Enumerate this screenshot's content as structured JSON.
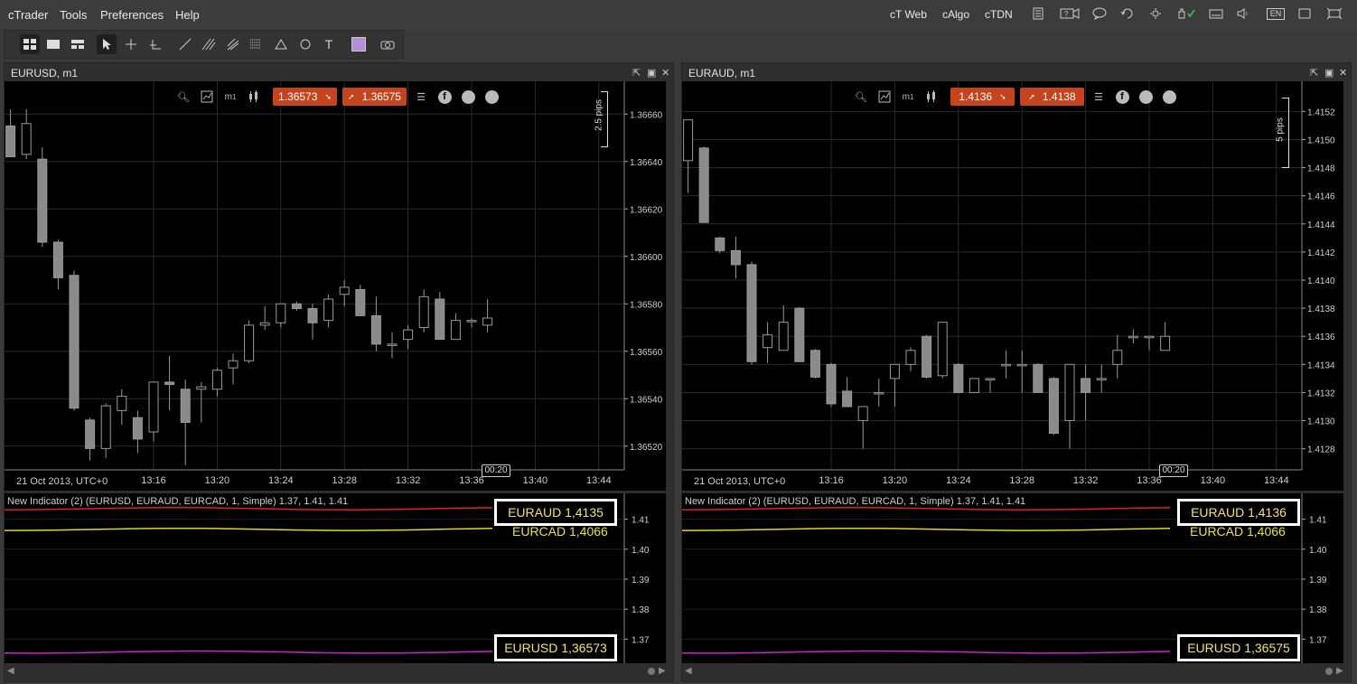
{
  "menu": {
    "items": [
      "cTrader",
      "Tools",
      "Preferences",
      "Help"
    ]
  },
  "top_links": [
    "cT Web",
    "cAlgo",
    "cTDN"
  ],
  "top_icons": [
    "notes-icon",
    "video-icon",
    "chat-icon",
    "refresh-icon",
    "settings-icon",
    "hand-check-icon",
    "keyboard-icon",
    "volume-icon",
    "language-icon",
    "window-icon",
    "fullscreen-icon"
  ],
  "language": "EN",
  "toolbar": {
    "tools": [
      "layout-grid-icon",
      "layout-single-icon",
      "layout-split-icon",
      "cursor-icon",
      "crosshair-icon",
      "measure-icon",
      "line-icon",
      "fib-icon",
      "pitchfork-icon",
      "fib-grid-icon",
      "triangle-icon",
      "ellipse-icon",
      "text-icon",
      "color-swatch",
      "screenshot-icon"
    ],
    "text_tool": "T",
    "swatch_color": "#b48fd6"
  },
  "panels": [
    {
      "title": "EURUSD, m1",
      "sell_price": "1.36573",
      "buy_price": "1.36575",
      "period_label": "m",
      "period_value": "1",
      "pips_label": "2.5 pips",
      "price_ticks": [
        "1.36660",
        "1.36640",
        "1.36620",
        "1.36600",
        "1.36580",
        "1.36560",
        "1.36540",
        "1.36520"
      ],
      "time_ticks": [
        "13:16",
        "13:20",
        "13:24",
        "13:28",
        "13:32",
        "13:36",
        "13:40",
        "13:44"
      ],
      "date_label": "21 Oct 2013, UTC+0",
      "countdown": "00:20",
      "indicator_label": "New Indicator (2) (EURUSD, EURAUD, EURCAD, 1, Simple) 1.37, 1.41, 1.41",
      "ind_ticks": [
        "1.41",
        "1.40",
        "1.39",
        "1.38",
        "1.37"
      ],
      "overlay_top": "EURAUD 1,4135",
      "overlay_mid": "EURCAD 1,4066",
      "overlay_bottom": "EURUSD 1,36573"
    },
    {
      "title": "EURAUD, m1",
      "sell_price": "1.4136",
      "buy_price": "1.4138",
      "period_label": "m",
      "period_value": "1",
      "pips_label": "5 pips",
      "price_ticks": [
        "1.4152",
        "1.4150",
        "1.4148",
        "1.4146",
        "1.4144",
        "1.4142",
        "1.4140",
        "1.4138",
        "1.4136",
        "1.4134",
        "1.4132",
        "1.4130",
        "1.4128"
      ],
      "time_ticks": [
        "13:16",
        "13:20",
        "13:24",
        "13:28",
        "13:32",
        "13:36",
        "13:40",
        "13:44"
      ],
      "date_label": "21 Oct 2013, UTC+0",
      "countdown": "00:20",
      "indicator_label": "New Indicator (2) (EURUSD, EURAUD, EURCAD, 1, Simple) 1.37, 1.41, 1.41",
      "ind_ticks": [
        "1.41",
        "1.40",
        "1.39",
        "1.38",
        "1.37"
      ],
      "overlay_top": "EURAUD 1,4136",
      "overlay_mid": "EURCAD 1,4066",
      "overlay_bottom": "EURUSD 1,36575"
    }
  ],
  "chart_data": [
    {
      "type": "candlestick",
      "symbol": "EURUSD",
      "timeframe": "m1",
      "ylim": [
        1.3651,
        1.3667
      ],
      "candles": [
        {
          "t": "13:07",
          "o": 1.36655,
          "h": 1.36662,
          "l": 1.36642,
          "c": 1.36642
        },
        {
          "t": "13:08",
          "o": 1.36643,
          "h": 1.36662,
          "l": 1.36641,
          "c": 1.36656
        },
        {
          "t": "13:09",
          "o": 1.36641,
          "h": 1.36646,
          "l": 1.36604,
          "c": 1.36606
        },
        {
          "t": "13:10",
          "o": 1.36606,
          "h": 1.36607,
          "l": 1.36586,
          "c": 1.36591
        },
        {
          "t": "13:11",
          "o": 1.36592,
          "h": 1.36594,
          "l": 1.36535,
          "c": 1.36536
        },
        {
          "t": "13:12",
          "o": 1.36531,
          "h": 1.36532,
          "l": 1.36514,
          "c": 1.36519
        },
        {
          "t": "13:13",
          "o": 1.36519,
          "h": 1.36538,
          "l": 1.36515,
          "c": 1.36537
        },
        {
          "t": "13:14",
          "o": 1.36535,
          "h": 1.36544,
          "l": 1.36529,
          "c": 1.36541
        },
        {
          "t": "13:15",
          "o": 1.36532,
          "h": 1.36535,
          "l": 1.36517,
          "c": 1.36523
        },
        {
          "t": "13:16",
          "o": 1.36526,
          "h": 1.36547,
          "l": 1.36522,
          "c": 1.36547
        },
        {
          "t": "13:17",
          "o": 1.36547,
          "h": 1.36558,
          "l": 1.36535,
          "c": 1.36546
        },
        {
          "t": "13:18",
          "o": 1.36544,
          "h": 1.36548,
          "l": 1.36512,
          "c": 1.3653
        },
        {
          "t": "13:19",
          "o": 1.36544,
          "h": 1.36547,
          "l": 1.3653,
          "c": 1.36545
        },
        {
          "t": "13:20",
          "o": 1.36544,
          "h": 1.36553,
          "l": 1.36541,
          "c": 1.36552
        },
        {
          "t": "13:21",
          "o": 1.36553,
          "h": 1.36559,
          "l": 1.36546,
          "c": 1.36556
        },
        {
          "t": "13:22",
          "o": 1.36556,
          "h": 1.36573,
          "l": 1.36555,
          "c": 1.36571
        },
        {
          "t": "13:23",
          "o": 1.36571,
          "h": 1.36579,
          "l": 1.36569,
          "c": 1.36572
        },
        {
          "t": "13:24",
          "o": 1.36572,
          "h": 1.3658,
          "l": 1.3657,
          "c": 1.3658
        },
        {
          "t": "13:25",
          "o": 1.3658,
          "h": 1.36581,
          "l": 1.36577,
          "c": 1.36578
        },
        {
          "t": "13:26",
          "o": 1.36578,
          "h": 1.3658,
          "l": 1.36565,
          "c": 1.36572
        },
        {
          "t": "13:27",
          "o": 1.36573,
          "h": 1.36584,
          "l": 1.3657,
          "c": 1.36582
        },
        {
          "t": "13:28",
          "o": 1.36584,
          "h": 1.3659,
          "l": 1.36579,
          "c": 1.36587
        },
        {
          "t": "13:29",
          "o": 1.36586,
          "h": 1.36588,
          "l": 1.36575,
          "c": 1.36575
        },
        {
          "t": "13:30",
          "o": 1.36575,
          "h": 1.36583,
          "l": 1.3656,
          "c": 1.36563
        },
        {
          "t": "13:31",
          "o": 1.36563,
          "h": 1.36568,
          "l": 1.36557,
          "c": 1.36563
        },
        {
          "t": "13:32",
          "o": 1.36565,
          "h": 1.36571,
          "l": 1.36561,
          "c": 1.36569
        },
        {
          "t": "13:33",
          "o": 1.3657,
          "h": 1.36586,
          "l": 1.36568,
          "c": 1.36583
        },
        {
          "t": "13:34",
          "o": 1.36582,
          "h": 1.36585,
          "l": 1.36565,
          "c": 1.36565
        },
        {
          "t": "13:35",
          "o": 1.36565,
          "h": 1.36576,
          "l": 1.36565,
          "c": 1.36573
        },
        {
          "t": "13:36",
          "o": 1.36573,
          "h": 1.36574,
          "l": 1.3657,
          "c": 1.36573
        },
        {
          "t": "13:37",
          "o": 1.36571,
          "h": 1.36582,
          "l": 1.36568,
          "c": 1.36574
        }
      ]
    },
    {
      "type": "candlestick",
      "symbol": "EURAUD",
      "timeframe": "m1",
      "ylim": [
        1.41265,
        1.41535
      ],
      "candles": [
        {
          "t": "13:07",
          "o": 1.41485,
          "h": 1.41512,
          "l": 1.41462,
          "c": 1.41514
        },
        {
          "t": "13:08",
          "o": 1.41494,
          "h": 1.41495,
          "l": 1.41441,
          "c": 1.41441
        },
        {
          "t": "13:09",
          "o": 1.4143,
          "h": 1.41431,
          "l": 1.41419,
          "c": 1.41421
        },
        {
          "t": "13:10",
          "o": 1.41421,
          "h": 1.41431,
          "l": 1.41401,
          "c": 1.41411
        },
        {
          "t": "13:11",
          "o": 1.41411,
          "h": 1.41413,
          "l": 1.4134,
          "c": 1.41342
        },
        {
          "t": "13:12",
          "o": 1.41352,
          "h": 1.4137,
          "l": 1.41341,
          "c": 1.41361
        },
        {
          "t": "13:13",
          "o": 1.4135,
          "h": 1.41382,
          "l": 1.4135,
          "c": 1.4137
        },
        {
          "t": "13:14",
          "o": 1.4138,
          "h": 1.41381,
          "l": 1.41342,
          "c": 1.41342
        },
        {
          "t": "13:15",
          "o": 1.4135,
          "h": 1.41351,
          "l": 1.4133,
          "c": 1.41331
        },
        {
          "t": "13:16",
          "o": 1.4134,
          "h": 1.41341,
          "l": 1.4131,
          "c": 1.41312
        },
        {
          "t": "13:17",
          "o": 1.41321,
          "h": 1.41331,
          "l": 1.4131,
          "c": 1.4131
        },
        {
          "t": "13:18",
          "o": 1.413,
          "h": 1.4131,
          "l": 1.4128,
          "c": 1.4131
        },
        {
          "t": "13:19",
          "o": 1.4132,
          "h": 1.4133,
          "l": 1.4131,
          "c": 1.4132
        },
        {
          "t": "13:20",
          "o": 1.4133,
          "h": 1.4134,
          "l": 1.4131,
          "c": 1.4134
        },
        {
          "t": "13:21",
          "o": 1.4134,
          "h": 1.41352,
          "l": 1.41335,
          "c": 1.4135
        },
        {
          "t": "13:22",
          "o": 1.4136,
          "h": 1.41361,
          "l": 1.4133,
          "c": 1.41331
        },
        {
          "t": "13:23",
          "o": 1.41332,
          "h": 1.4137,
          "l": 1.4133,
          "c": 1.4137
        },
        {
          "t": "13:24",
          "o": 1.4134,
          "h": 1.41341,
          "l": 1.4132,
          "c": 1.4132
        },
        {
          "t": "13:25",
          "o": 1.4132,
          "h": 1.4133,
          "l": 1.4132,
          "c": 1.4133
        },
        {
          "t": "13:26",
          "o": 1.4133,
          "h": 1.4133,
          "l": 1.4132,
          "c": 1.4133
        },
        {
          "t": "13:27",
          "o": 1.4134,
          "h": 1.4135,
          "l": 1.4133,
          "c": 1.4134
        },
        {
          "t": "13:28",
          "o": 1.4134,
          "h": 1.4135,
          "l": 1.4132,
          "c": 1.4134
        },
        {
          "t": "13:29",
          "o": 1.4134,
          "h": 1.41341,
          "l": 1.4132,
          "c": 1.4132
        },
        {
          "t": "13:30",
          "o": 1.4133,
          "h": 1.41331,
          "l": 1.4129,
          "c": 1.41291
        },
        {
          "t": "13:31",
          "o": 1.413,
          "h": 1.4134,
          "l": 1.4128,
          "c": 1.4134
        },
        {
          "t": "13:32",
          "o": 1.4133,
          "h": 1.4134,
          "l": 1.413,
          "c": 1.4132
        },
        {
          "t": "13:33",
          "o": 1.4133,
          "h": 1.4134,
          "l": 1.4132,
          "c": 1.4133
        },
        {
          "t": "13:34",
          "o": 1.4134,
          "h": 1.41361,
          "l": 1.4133,
          "c": 1.4135
        },
        {
          "t": "13:35",
          "o": 1.4136,
          "h": 1.41365,
          "l": 1.41355,
          "c": 1.4136
        },
        {
          "t": "13:36",
          "o": 1.4136,
          "h": 1.4136,
          "l": 1.4135,
          "c": 1.4136
        },
        {
          "t": "13:37",
          "o": 1.4135,
          "h": 1.4137,
          "l": 1.4135,
          "c": 1.4136
        }
      ]
    }
  ],
  "indicator_data": {
    "ylim": [
      1.365,
      1.415
    ],
    "series": [
      {
        "name": "EURAUD",
        "color": "#e02020",
        "value": 1.4135
      },
      {
        "name": "EURCAD",
        "color": "#e0d820",
        "value": 1.4066
      },
      {
        "name": "EURUSD",
        "color": "#d020d0",
        "value": 1.3657
      }
    ]
  },
  "colors": {
    "sell_chip": "#c5431d",
    "candle": "#8a8a8a",
    "background": "#000000"
  }
}
